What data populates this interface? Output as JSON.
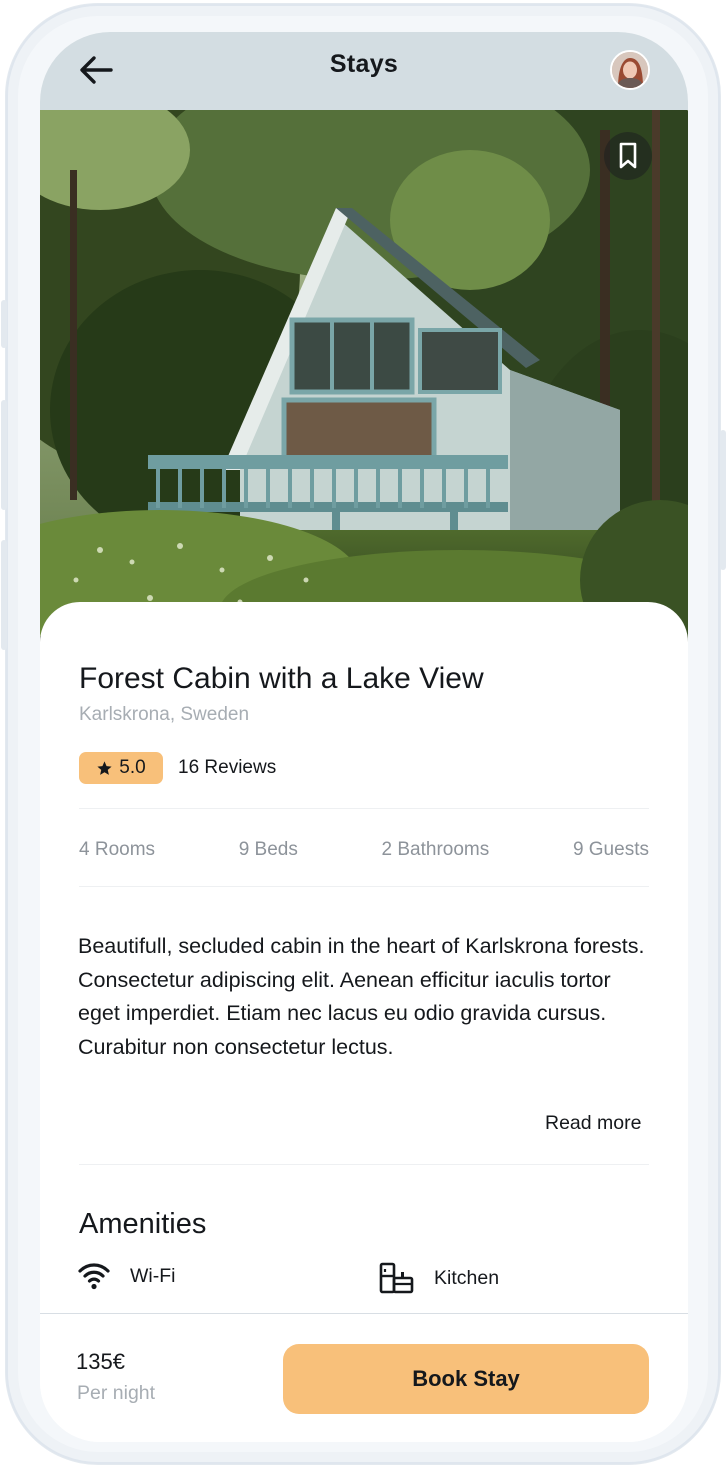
{
  "header": {
    "title": "Stays"
  },
  "icons": {
    "back": "arrow-left-icon",
    "avatar": "user-avatar",
    "bookmark": "bookmark-icon",
    "star": "star-icon",
    "wifi": "wifi-icon",
    "kitchen": "kitchen-icon"
  },
  "gallery": {
    "dot_count": 5,
    "active_dot": 2
  },
  "listing": {
    "title": "Forest Cabin with a Lake View",
    "location": "Karlskrona, Sweden",
    "rating": "5.0",
    "reviews": "16 Reviews",
    "specs": [
      "4 Rooms",
      "9 Beds",
      "2 Bathrooms",
      "9 Guests"
    ],
    "description": "Beautifull, secluded cabin in the heart of Karlskrona forests. Consectetur adipiscing elit. Aenean efficitur iaculis tortor eget imperdiet. Etiam nec lacus eu odio gravida cursus. Curabitur non consectetur lectus.",
    "read_more": "Read more"
  },
  "amenities": {
    "title": "Amenities",
    "items": [
      "Wi-Fi",
      "Kitchen"
    ]
  },
  "booking": {
    "price": "135€",
    "per_night": "Per night",
    "button_label": "Book Stay"
  },
  "colors": {
    "accent": "#f8c07a",
    "header_bg": "#d3dde2",
    "text": "#15181c",
    "muted": "#a7adb3"
  }
}
